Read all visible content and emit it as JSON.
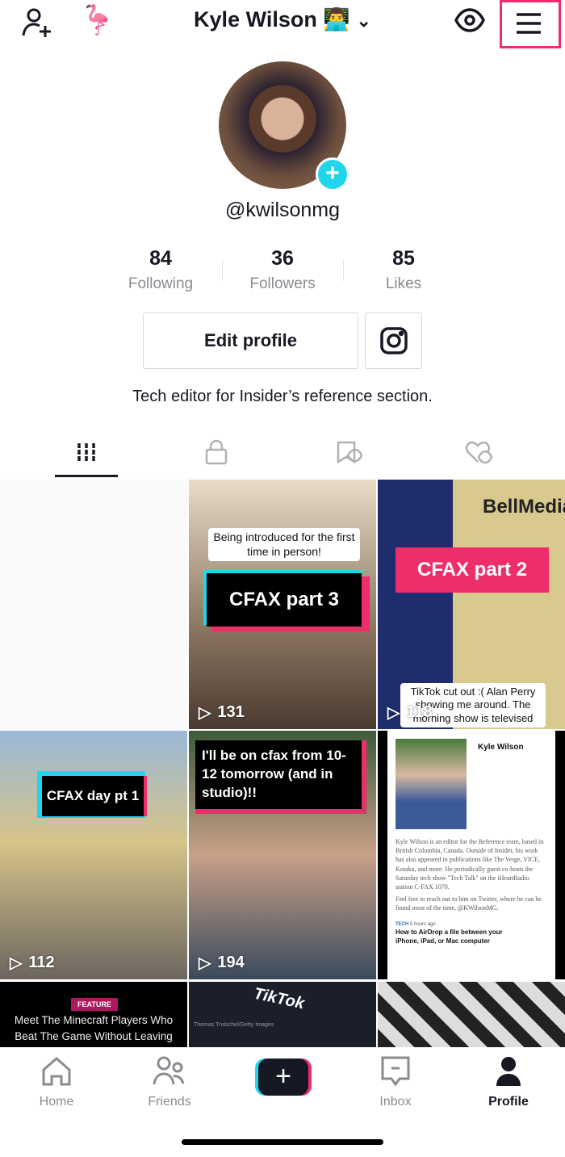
{
  "header": {
    "title": "Kyle Wilson",
    "title_emoji": "👨‍💻",
    "flamingo_emoji": "🦩"
  },
  "profile": {
    "handle": "@kwilsonmg",
    "bio": "Tech editor for Insider’s reference section.",
    "stats": [
      {
        "value": "84",
        "label": "Following"
      },
      {
        "value": "36",
        "label": "Followers"
      },
      {
        "value": "85",
        "label": "Likes"
      }
    ],
    "edit_label": "Edit profile"
  },
  "colors": {
    "accent": "#ee2d6b",
    "cyan": "#20d5ec",
    "text": "#161823",
    "muted": "#8a8b91"
  },
  "videos": [
    {
      "count": ""
    },
    {
      "caption": "Being introduced for the first time in person!",
      "title": "CFAX part 3",
      "count": "131"
    },
    {
      "brand": "BellMedia",
      "title": "CFAX part 2",
      "caption": "TikTok cut out :( Alan Perry showing me around. The morning show is televised",
      "count": "118"
    },
    {
      "title": "CFAX day pt 1",
      "count": "112"
    },
    {
      "title": "I'll be on cfax from 10-12 tomorrow (and in studio)!!",
      "count": "194"
    },
    {
      "name": "Kyle Wilson",
      "bio": "Kyle Wilson is an editor for the Reference team, based in British Columbia, Canada. Outside of Insider, his work has also appeared in publications like The Verge, VICE, Kotaku, and more. He periodically guest co-hosts the Saturday tech show \"Tech Talk\" on the iHeartRadio station C-FAX 1070.",
      "bio2": "Feel free to reach out to him on Twitter, where he can be found most of the time, @KWilsonMG.",
      "section": "TECH",
      "time": "5 hours ago",
      "headline": "How to AirDrop a file between your iPhone, iPad, or Mac computer"
    },
    {
      "badge": "FEATURE",
      "headline": "Meet The Minecraft Players Who Beat The Game Without Leaving"
    },
    {
      "logo": "TikTok",
      "credit": "Thomas Trutschel/Getty Images"
    },
    {}
  ],
  "nav": {
    "items": [
      {
        "label": "Home"
      },
      {
        "label": "Friends"
      },
      {
        "label": "Inbox"
      },
      {
        "label": "Profile"
      }
    ],
    "active": "Profile"
  }
}
